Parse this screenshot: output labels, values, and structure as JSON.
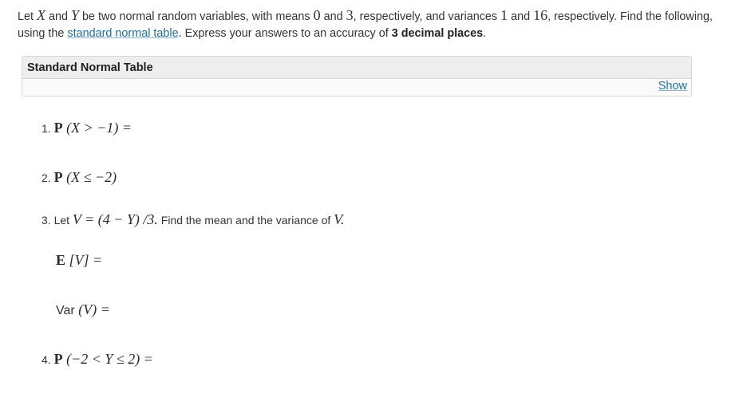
{
  "intro": {
    "part1": "Let ",
    "var_x": "X",
    "part2": " and ",
    "var_y": "Y",
    "part3": " be two normal random variables, with means ",
    "mean_x": "0",
    "part4": " and ",
    "mean_y": "3",
    "part5": ", respectively, and variances ",
    "var1": "1",
    "part6": " and ",
    "var2": "16",
    "part7": ", respectively. Find the following, using the ",
    "link_text": "standard normal table",
    "part8": ". Express your answers to an accuracy of ",
    "accuracy_text": "3 decimal places",
    "part9": "."
  },
  "table_panel": {
    "title": "Standard Normal Table",
    "show_label": "Show"
  },
  "questions": {
    "q1_num": "1. ",
    "q1_p": "P",
    "q1_expr": " (X > −1) =",
    "q2_num": "2. ",
    "q2_p": "P",
    "q2_expr": " (X ≤ −2)",
    "q3_num": "3. Let ",
    "q3_expr": "V = (4 − Y) /3.",
    "q3_text": " Find the mean and the variance of ",
    "q3_var": "V.",
    "q3b_e": "E",
    "q3b_expr": " [V] =",
    "q3c_label": "Var",
    "q3c_expr": " (V) =",
    "q4_num": "4. ",
    "q4_p": "P",
    "q4_expr": " (−2 < Y ≤ 2) ="
  }
}
